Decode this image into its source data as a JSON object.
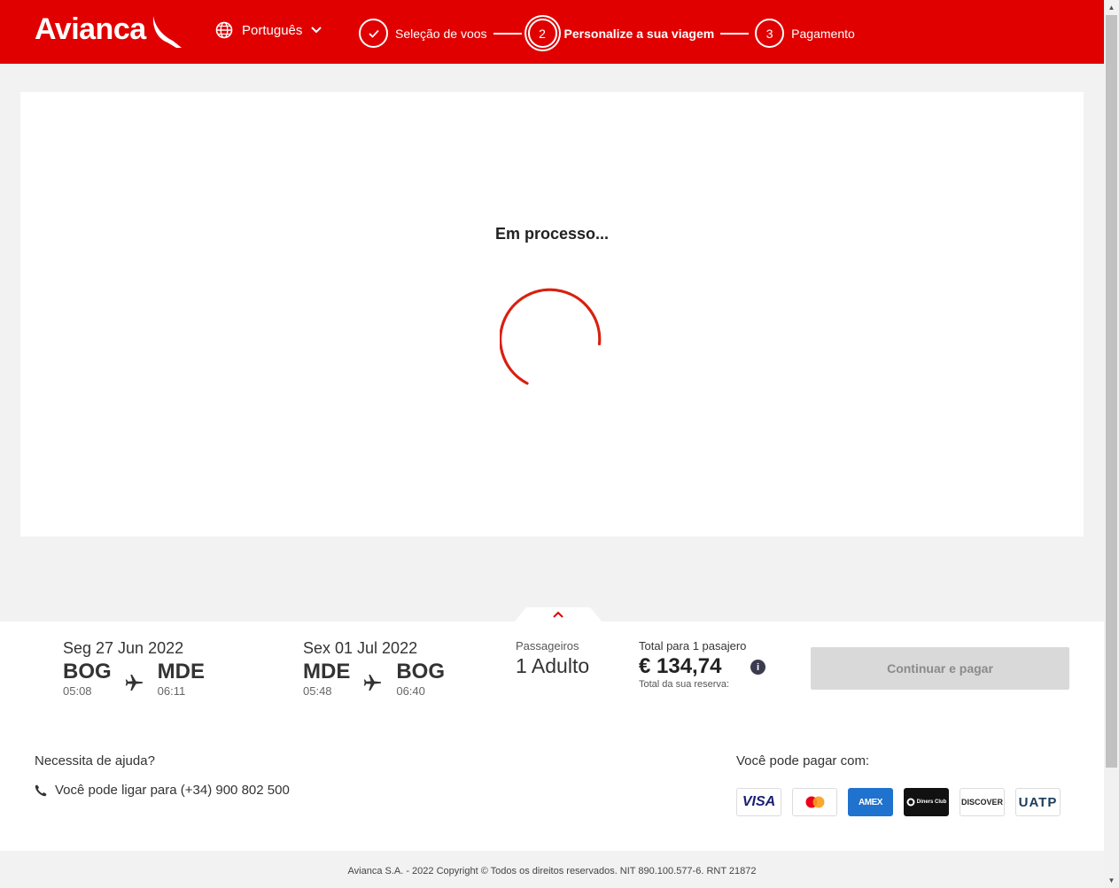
{
  "header": {
    "logo_text": "Avianca",
    "language": "Português",
    "steps": [
      {
        "number": "1",
        "label": "Seleção de voos",
        "state": "done"
      },
      {
        "number": "2",
        "label": "Personalize a sua viagem",
        "state": "active"
      },
      {
        "number": "3",
        "label": "Pagamento",
        "state": "pending"
      }
    ]
  },
  "main": {
    "processing_text": "Em processo..."
  },
  "summary": {
    "outbound": {
      "date": "Seg 27 Jun 2022",
      "from": "BOG",
      "from_time": "05:08",
      "to": "MDE",
      "to_time": "06:11"
    },
    "return": {
      "date": "Sex 01 Jul 2022",
      "from": "MDE",
      "from_time": "05:48",
      "to": "BOG",
      "to_time": "06:40"
    },
    "passengers_label": "Passageiros",
    "passengers_value": "1 Adulto",
    "total_label": "Total para 1 pasajero",
    "total_price": "€ 134,74",
    "total_sub": "Total da sua reserva:",
    "info_icon": "i",
    "continue_label": "Continuar e pagar"
  },
  "help": {
    "title": "Necessita de ajuda?",
    "phone_text": "Você pode ligar para (+34) 900 802 500"
  },
  "payments": {
    "title": "Você pode pagar com:",
    "cards": [
      "VISA",
      "mastercard",
      "AMEX",
      "Diners Club",
      "DISCOVER",
      "UATP"
    ]
  },
  "footer": {
    "copyright": "Avianca S.A. - 2022 Copyright © Todos os direitos reservados. NIT 890.100.577-6. RNT 21872"
  },
  "colors": {
    "brand_red": "#e00000",
    "spinner": "#d9200f",
    "button_disabled": "#d9d9d9"
  }
}
